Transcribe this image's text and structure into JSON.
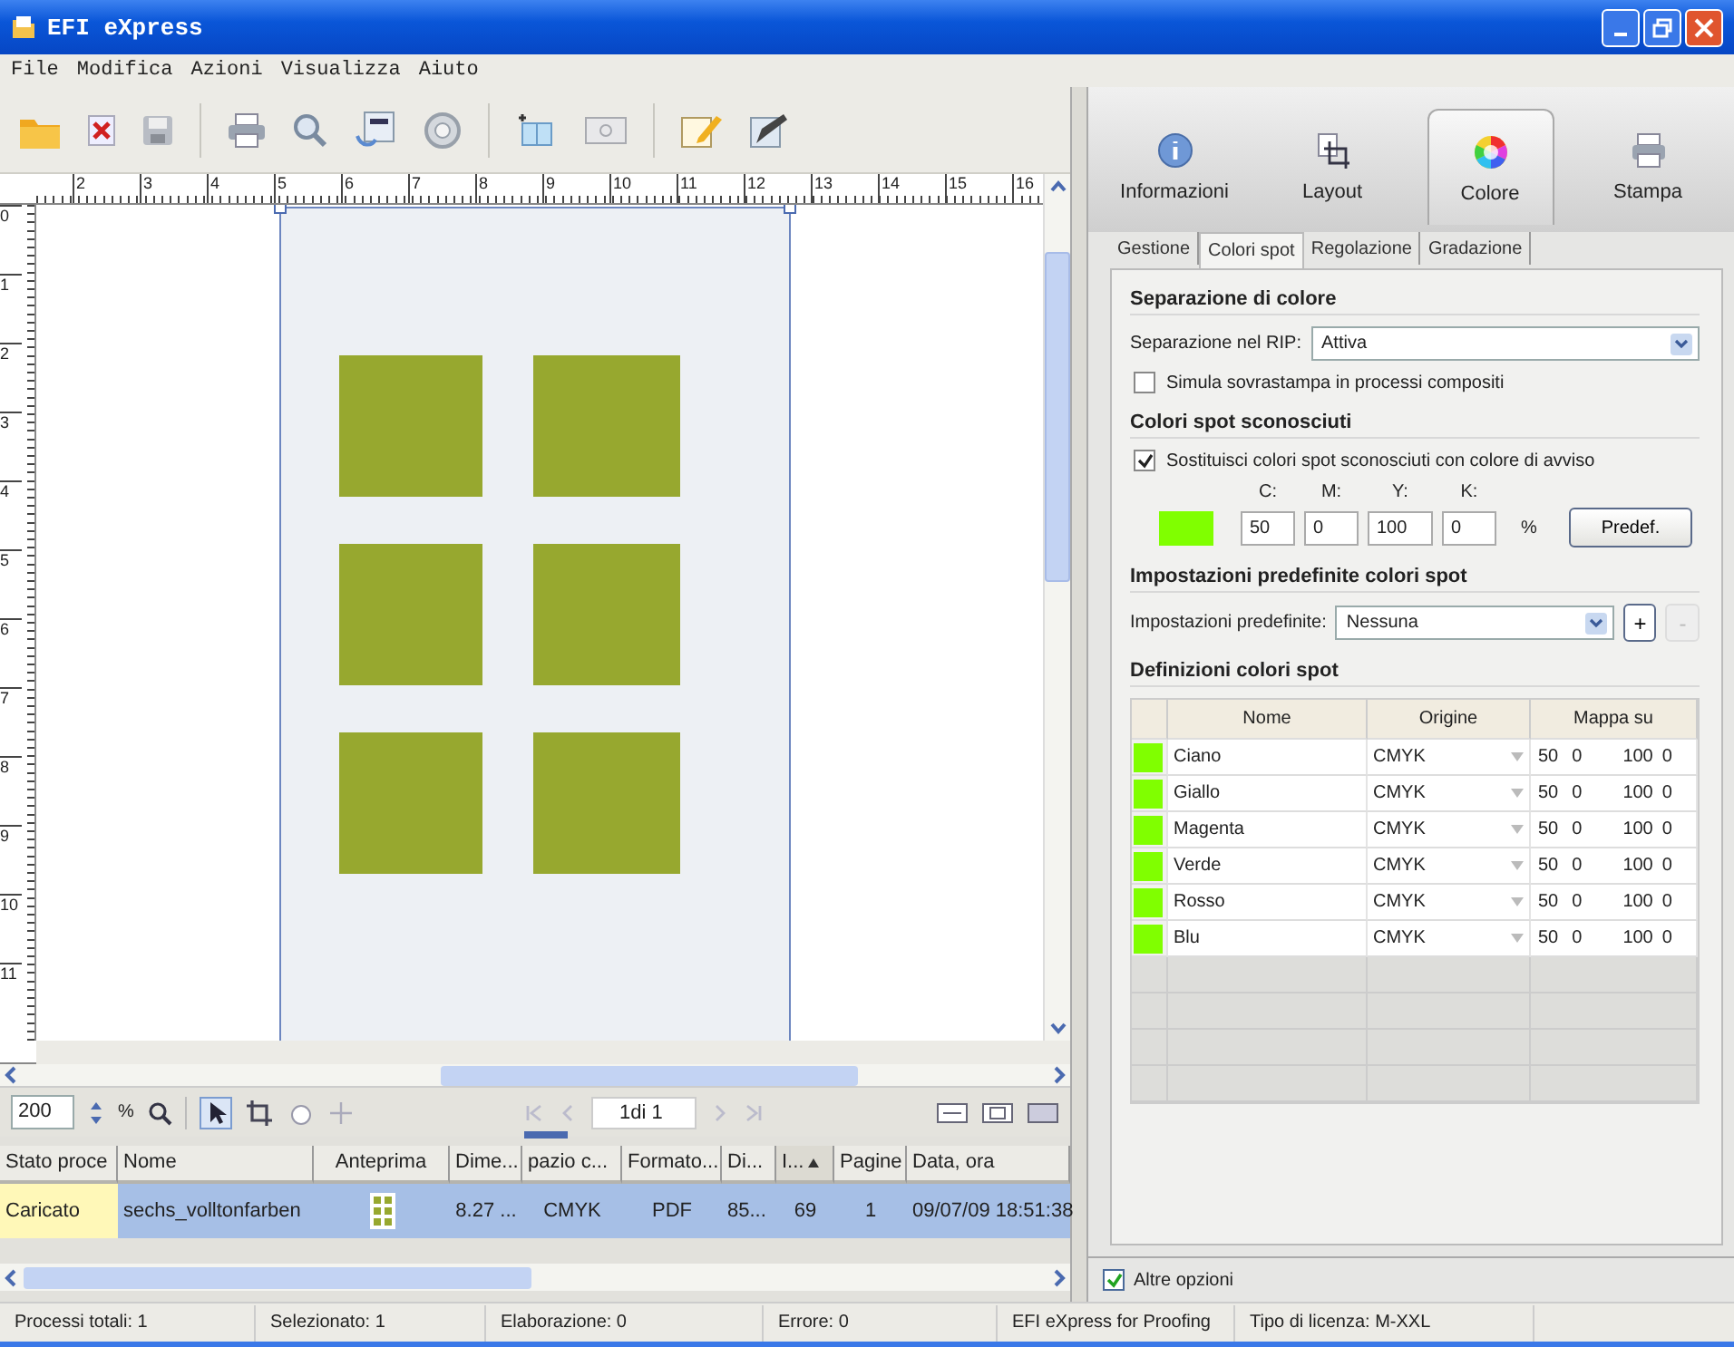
{
  "window": {
    "title": "EFI eXpress"
  },
  "menu": [
    "File",
    "Modifica",
    "Azioni",
    "Visualizza",
    "Aiuto"
  ],
  "rulers": {
    "horizontal": [
      "2",
      "3",
      "4",
      "5",
      "6",
      "7",
      "8",
      "9",
      "10",
      "11",
      "12",
      "13",
      "14",
      "15",
      "16"
    ],
    "vertical": [
      "0",
      "1",
      "2",
      "3",
      "4",
      "5",
      "6",
      "7",
      "8",
      "9",
      "10",
      "11"
    ]
  },
  "view_bar": {
    "zoom": "200",
    "zoom_unit": "%",
    "page": "1di 1"
  },
  "jobs": {
    "columns": [
      {
        "label": "Stato proce",
        "sorted": false
      },
      {
        "label": "Nome",
        "sorted": false
      },
      {
        "label": "Anteprima",
        "sorted": false
      },
      {
        "label": "Dime...",
        "sorted": false
      },
      {
        "label": "pazio c...",
        "sorted": false
      },
      {
        "label": "Formato...",
        "sorted": false
      },
      {
        "label": "Di...",
        "sorted": false
      },
      {
        "label": "I...",
        "sorted": true
      },
      {
        "label": "Pagine",
        "sorted": false
      },
      {
        "label": "Data, ora",
        "sorted": false
      }
    ],
    "rows": [
      {
        "selected": true,
        "status": "Caricato",
        "name": "sechs_volltonfarben",
        "size": "8.27 ...",
        "space": "CMYK",
        "format": "PDF",
        "col_7": "85...",
        "col_8": "69",
        "pages": "1",
        "date": "09/07/09 18:51:38"
      }
    ]
  },
  "right_panel": {
    "tabs": [
      {
        "label": "Informazioni",
        "kind": "info",
        "selected": false
      },
      {
        "label": "Layout",
        "kind": "layout",
        "selected": false
      },
      {
        "label": "Colore",
        "kind": "color",
        "selected": true
      },
      {
        "label": "Stampa",
        "kind": "print",
        "selected": false
      }
    ],
    "subtabs": [
      {
        "label": "Gestione",
        "selected": false
      },
      {
        "label": "Colori spot",
        "selected": true
      },
      {
        "label": "Regolazione",
        "selected": false
      },
      {
        "label": "Gradazione",
        "selected": false
      }
    ],
    "color_separation": {
      "heading": "Separazione di colore",
      "rip_label": "Separazione nel RIP:",
      "rip_value": "Attiva",
      "simulate": {
        "label": "Simula sovrastampa in processi compositi",
        "checked": false
      }
    },
    "unknown_spot": {
      "heading": "Colori spot sconosciuti",
      "replace": {
        "label": "Sostituisci colori spot sconosciuti con colore di avviso",
        "checked": true
      },
      "channels": [
        {
          "label": "C:",
          "value": "50"
        },
        {
          "label": "M:",
          "value": "0"
        },
        {
          "label": "Y:",
          "value": "100"
        },
        {
          "label": "K:",
          "value": "0"
        }
      ],
      "color": "#80ff00",
      "unit": "%",
      "default_button": "Predef."
    },
    "presets": {
      "heading": "Impostazioni predefinite colori spot",
      "label": "Impostazioni predefinite:",
      "value": "Nessuna",
      "add": {
        "label": "+",
        "disabled": false
      },
      "remove": {
        "label": "-",
        "disabled": true
      }
    },
    "definitions": {
      "heading": "Definizioni colori spot",
      "columns": [
        "Nome",
        "Origine",
        "Mappa su"
      ],
      "rows": [
        {
          "name": "Ciano",
          "color": "#80ff00",
          "origin": "CMYK",
          "map": [
            "50",
            "0",
            "100",
            "0"
          ]
        },
        {
          "name": "Giallo",
          "color": "#80ff00",
          "origin": "CMYK",
          "map": [
            "50",
            "0",
            "100",
            "0"
          ]
        },
        {
          "name": "Magenta",
          "color": "#80ff00",
          "origin": "CMYK",
          "map": [
            "50",
            "0",
            "100",
            "0"
          ]
        },
        {
          "name": "Verde",
          "color": "#80ff00",
          "origin": "CMYK",
          "map": [
            "50",
            "0",
            "100",
            "0"
          ]
        },
        {
          "name": "Rosso",
          "color": "#80ff00",
          "origin": "CMYK",
          "map": [
            "50",
            "0",
            "100",
            "0"
          ]
        },
        {
          "name": "Blu",
          "color": "#80ff00",
          "origin": "CMYK",
          "map": [
            "50",
            "0",
            "100",
            "0"
          ]
        }
      ]
    },
    "more_options": {
      "label": "Altre opzioni",
      "checked": true
    }
  },
  "status_bar": [
    "Processi totali: 1",
    "Selezionato: 1",
    "Elaborazione: 0",
    "Errore: 0",
    "EFI eXpress for Proofing",
    "Tipo di licenza: M-XXL"
  ]
}
